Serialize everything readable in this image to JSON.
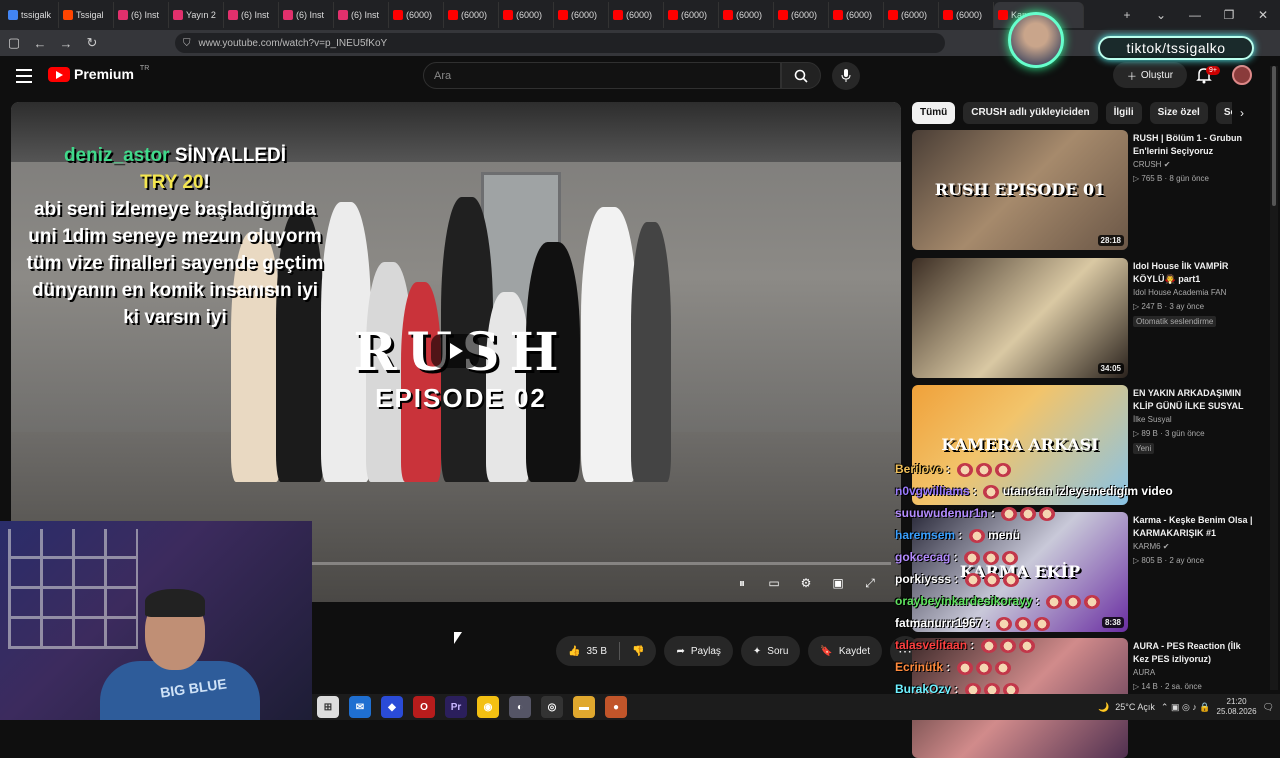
{
  "browser": {
    "tabs": [
      {
        "label": "tssigalk",
        "color": "#4285f4"
      },
      {
        "label": "Tssigal",
        "color": "#ff4500"
      },
      {
        "label": "(6) Inst",
        "color": "#e1306c"
      },
      {
        "label": "Yayın 2",
        "color": "#e1306c"
      },
      {
        "label": "(6) Inst",
        "color": "#e1306c"
      },
      {
        "label": "(6) Inst",
        "color": "#e1306c"
      },
      {
        "label": "(6) Inst",
        "color": "#e1306c"
      },
      {
        "label": "(6000)",
        "color": "#ff0000"
      },
      {
        "label": "(6000)",
        "color": "#ff0000"
      },
      {
        "label": "(6000)",
        "color": "#ff0000"
      },
      {
        "label": "(6000)",
        "color": "#ff0000"
      },
      {
        "label": "(6000)",
        "color": "#ff0000"
      },
      {
        "label": "(6000)",
        "color": "#ff0000"
      },
      {
        "label": "(6000)",
        "color": "#ff0000"
      },
      {
        "label": "(6000)",
        "color": "#ff0000"
      },
      {
        "label": "(6000)",
        "color": "#ff0000"
      },
      {
        "label": "(6000)",
        "color": "#ff0000"
      },
      {
        "label": "(6000)",
        "color": "#ff0000"
      }
    ],
    "active_tab_label": "Kanom",
    "url": "www.youtube.com/watch?v=p_INEU5fKoY"
  },
  "youtube": {
    "logo_text": "Premium",
    "logo_region": "TR",
    "search_placeholder": "Ara",
    "create_label": "Oluştur",
    "notification_count": "9+"
  },
  "overlay": {
    "tiktok_handle": "tiktok/tssigalko",
    "alert_user": "deniz_astor",
    "alert_action": "SİNYALLEDİ",
    "alert_amount": "TRY 20",
    "alert_message": "abi seni izlemeye başladığımda uni 1dim seneye mezun oluyorm tüm vize finalleri sayende geçtim dünyanın en komik insanısın iyi ki varsın iyi"
  },
  "video": {
    "title_logo": "RUSH",
    "episode": "EPISODE 02"
  },
  "webcam": {
    "shirt_text": "BIG BLUE"
  },
  "actions": {
    "likes": "35 B",
    "share": "Paylaş",
    "ask": "Soru",
    "save": "Kaydet"
  },
  "chips": [
    "Tümü",
    "CRUSH adlı yükleyiciden",
    "İlgili",
    "Size özel",
    "Son yükl"
  ],
  "recommendations": [
    {
      "title": "RUSH | Bölüm 1 - Grubun En'lerini Seçiyoruz",
      "channel": "CRUSH",
      "verified": true,
      "views": "765 B",
      "age": "8 gün önce",
      "duration": "28:18",
      "tag": "",
      "thumb_label": "RUSH EPISODE 01"
    },
    {
      "title": "Idol House İlk VAMPİR KÖYLÜ🧛 part1",
      "channel": "Idol House Academia FAN",
      "verified": false,
      "views": "247 B",
      "age": "3 ay önce",
      "duration": "34:05",
      "tag": "Otomatik seslendirme",
      "thumb_label": ""
    },
    {
      "title": "EN YAKIN ARKADAŞIMIN KLİP GÜNÜ İLKE SUSYAL",
      "channel": "İlke Susyal",
      "verified": false,
      "views": "89 B",
      "age": "3 gün önce",
      "duration": "",
      "tag": "Yeni",
      "thumb_label": "KAMERA ARKASI"
    },
    {
      "title": "Karma - Keşke Benim Olsa | KARMAKARIŞIK #1",
      "channel": "KARM6",
      "verified": true,
      "views": "805 B",
      "age": "2 ay önce",
      "duration": "8:38",
      "tag": "",
      "thumb_label": "KARMA EKİP"
    },
    {
      "title": "AURA - PES Reaction (İlk Kez PES izliyoruz)",
      "channel": "AURA",
      "verified": false,
      "views": "14 B",
      "age": "2 sa. önce",
      "duration": "",
      "tag": "",
      "thumb_label": ""
    }
  ],
  "chat": [
    {
      "user": "Berilovo",
      "text": "",
      "color": "#f0c05a"
    },
    {
      "user": "n0vgwilliams",
      "text": "utanctan izleyemedigim video",
      "color": "#9b7bff"
    },
    {
      "user": "suuuwudenur1n",
      "text": "",
      "color": "#b48cff"
    },
    {
      "user": "haremsem",
      "text": "menü",
      "color": "#3aa0ff"
    },
    {
      "user": "gokcecag",
      "text": "",
      "color": "#b48cff"
    },
    {
      "user": "porkiysss",
      "text": "",
      "color": "#ffffff"
    },
    {
      "user": "oraybeyinkardesikorayy",
      "text": "",
      "color": "#5fe35f"
    },
    {
      "user": "fatmanurrr1967",
      "text": "",
      "color": "#ffffff"
    },
    {
      "user": "talasvelitaan",
      "text": "",
      "color": "#ff4040"
    },
    {
      "user": "Ecrinütk",
      "text": "",
      "color": "#ff8a3d"
    },
    {
      "user": "BurakOzy",
      "text": "",
      "color": "#6ef0ff"
    }
  ],
  "taskbar": {
    "weather": "25°C Açık",
    "time": "21:20",
    "date": "25.08.2026"
  }
}
